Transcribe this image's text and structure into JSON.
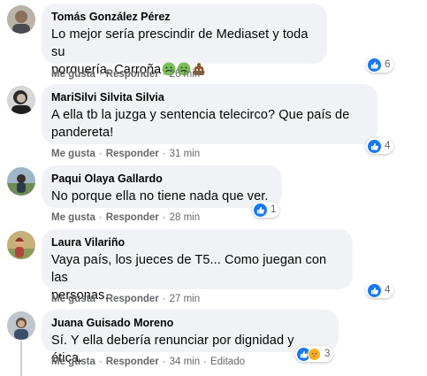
{
  "comments": [
    {
      "author": "Tomás González Pérez",
      "text_lines": [
        "Lo mejor sería prescindir de Mediaset y toda su",
        "porquería. Carroña"
      ],
      "emojis": [
        "nauseated-face-emoji",
        "nauseated-face-emoji",
        "pile-of-poo-emoji"
      ],
      "like": "Me gusta",
      "reply": "Responder",
      "time": "26 min",
      "reactions": "6"
    },
    {
      "author": "MariSilvi Silvita Silvia",
      "text_lines": [
        "A ella tb la juzga y sentencia telecirco? Que país de",
        "pandereta!"
      ],
      "like": "Me gusta",
      "reply": "Responder",
      "time": "31 min",
      "reactions": "4"
    },
    {
      "author": "Paqui Olaya Gallardo",
      "text_lines": [
        "No porque ella no tiene nada que ver."
      ],
      "like": "Me gusta",
      "reply": "Responder",
      "time": "28 min",
      "reactions": "1"
    },
    {
      "author": "Laura Vilariño",
      "text_lines": [
        "Vaya país, los jueces de T5... Como juegan con las",
        "personas."
      ],
      "like": "Me gusta",
      "reply": "Responder",
      "time": "27 min",
      "reactions": "4"
    },
    {
      "author": "Juana Guisado Moreno",
      "text_lines": [
        "Sí. Y ella debería renunciar por dignidad y ética."
      ],
      "like": "Me gusta",
      "reply": "Responder",
      "time": "34 min",
      "edited": "Editado",
      "reactions": "3"
    }
  ],
  "colors": {
    "bubble": "#f0f2f5",
    "like_blue": "#1877f2",
    "meta_gray": "#65676b"
  }
}
